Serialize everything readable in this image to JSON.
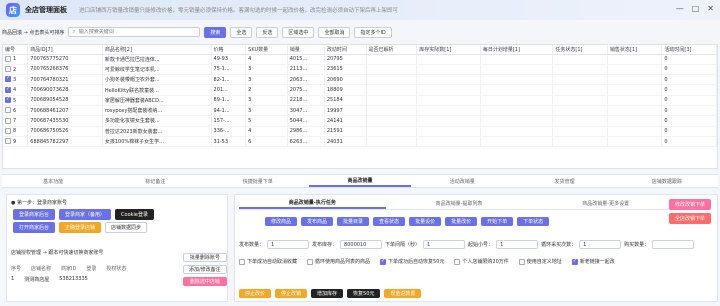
{
  "app": {
    "title": "全店管理面板",
    "notice": "进口店铺西万销量改销量只能修改价格，零元销量必须保持价格。客满勾选的时候一起改价格，改完检测必须自动下架后再上架即可"
  },
  "window": {
    "minimize": "—",
    "maximize": "□",
    "close": "✕"
  },
  "toolbar": {
    "label": "商品回滚 → 点击表头可排序",
    "search_placeholder": "输入搜索关键词",
    "search_button": "搜索",
    "buttons": [
      "全选",
      "反选",
      "区域选中",
      "全部取消",
      "指定多个ID"
    ]
  },
  "table": {
    "headers": [
      "编号",
      "商品ID[7]",
      "商品名称[2]",
      "价格",
      "SKU数量",
      "销量",
      "改动时间",
      "是否已解析",
      "库存实际数[1]",
      "每日计划增量[1]",
      "任务状态[1]",
      "销售状态[1]",
      "活动时间[3]"
    ],
    "rows": [
      {
        "no": "1",
        "id": "700765775270",
        "name": "新款卡通巴拉巴拉连体...",
        "price": "49-93",
        "sku": "4",
        "sales": "4015...",
        "mod": "20795",
        "checked": false,
        "v": "0"
      },
      {
        "no": "2",
        "id": "700765268376",
        "name": "可爱鲸纹学生笔记本机...",
        "price": "75-1...",
        "sku": "3",
        "sales": "2113...",
        "mod": "23615",
        "checked": false,
        "v": "0"
      },
      {
        "no": "3",
        "id": "700764780321",
        "name": "小狗冬装带帽卫衣外套...",
        "price": "82-1...",
        "sku": "3",
        "sales": "2063...",
        "mod": "20690",
        "checked": true,
        "v": "0"
      },
      {
        "no": "4",
        "id": "700690073628",
        "name": "HelloKitty联名款童装...",
        "price": "201...",
        "sku": "2",
        "sales": "2075...",
        "mod": "18809",
        "checked": true,
        "v": "0"
      },
      {
        "no": "5",
        "id": "700689054528",
        "name": "家居解压神器套装ABCD...",
        "price": "89-1...",
        "sku": "3",
        "sales": "2218...",
        "mod": "25184",
        "checked": true,
        "v": "0"
      },
      {
        "no": "6",
        "id": "700688461207",
        "name": "rosypoxy搭配套装收纳...",
        "price": "94-1...",
        "sku": "3",
        "sales": "3047...",
        "mod": "19997",
        "checked": false,
        "v": "0"
      },
      {
        "no": "7",
        "id": "700687435530",
        "name": "多功能化妆镜女生套装...",
        "price": "157-...",
        "sku": "5",
        "sales": "5044...",
        "mod": "24141",
        "checked": false,
        "v": "0"
      },
      {
        "no": "8",
        "id": "700686750526",
        "name": "普拉达2023新款女装套...",
        "price": "336-...",
        "sku": "4",
        "sales": "2986...",
        "mod": "21591",
        "checked": false,
        "v": "0"
      },
      {
        "no": "9",
        "id": "688845782297",
        "name": "女孩100%棉袜子女生学...",
        "price": "31-53",
        "sku": "6",
        "sales": "6263...",
        "mod": "24031",
        "checked": false,
        "v": "0"
      }
    ]
  },
  "tabs": [
    "基本功能",
    "标记备注",
    "快捷批量下单",
    "商品改销量",
    "活动改销量",
    "发货管理",
    "店铺数据跟踪"
  ],
  "active_tab": 3,
  "login": {
    "step1": "● 第一步：登录商家账号",
    "row1": [
      "登录商家后台",
      "登录商家（备用）",
      "Cookie登录"
    ],
    "row2": [
      "打开商家后台",
      "正确登录店铺",
      "店铺数据同步"
    ]
  },
  "bind": {
    "title": "店铺授权管理 → 跟本可快速切换商家账号",
    "cols": [
      "序号",
      "店铺名称",
      "商家ID",
      "登录",
      "授权状态"
    ],
    "row": [
      "1",
      "测测商店屋",
      "538213335",
      "",
      ""
    ],
    "side": [
      "批量删除账号",
      "添加/修改备注",
      "删除选中店铺"
    ]
  },
  "right": {
    "sub_tabs": [
      "商品改销量-执行任务",
      "商品改销量-提取列表",
      "商品改销量-更多设置"
    ],
    "side": [
      "修改改销下单",
      "全店改销下单"
    ],
    "actions": [
      "修改商品",
      "发布商品",
      "批量目录",
      "查看状态",
      "批量设价",
      "批量改价",
      "开始下单",
      "下单状态"
    ],
    "params_labels": [
      "发布数量：",
      "发布库存：",
      "下单间隔（秒）",
      "起始小号：",
      "循环采买次数：",
      "购买数量："
    ],
    "params_values": [
      "1",
      "8000010",
      "1",
      "1",
      "1",
      ""
    ],
    "options": [
      "下单成功自动取消收藏",
      "循环使用商品列表的商品",
      "下单成功后自动恢复50元",
      "个人店铺限购20万件",
      "使用自定义地址",
      "新老链接一起改"
    ],
    "bottom": [
      "停止改价",
      "停止改销",
      "增加库存",
      "恢复50元",
      "现金返款置"
    ]
  }
}
